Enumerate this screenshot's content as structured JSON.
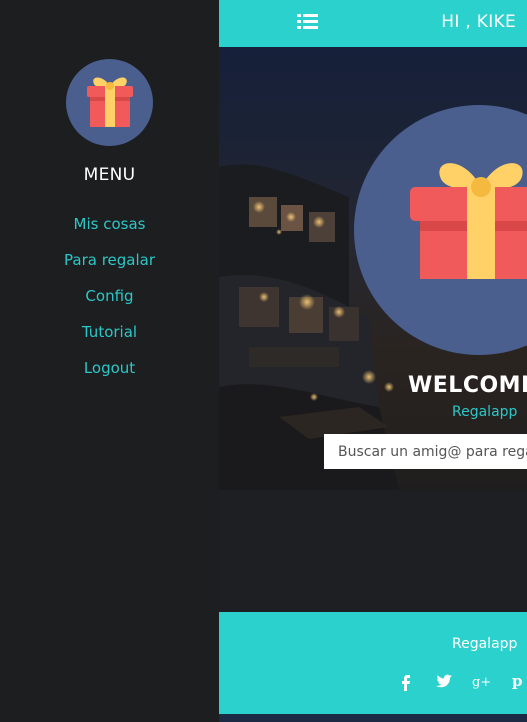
{
  "sidebar": {
    "logo": "gift-icon",
    "menu_title": "MENU",
    "items": [
      {
        "label": "Mis cosas"
      },
      {
        "label": "Para regalar"
      },
      {
        "label": "Config"
      },
      {
        "label": "Tutorial"
      },
      {
        "label": "Logout"
      }
    ]
  },
  "header": {
    "menu_icon": "list-icon",
    "greeting": "HI , KIKE"
  },
  "hero": {
    "logo": "gift-icon",
    "title": "WELCOME",
    "subtitle": "Regalapp",
    "search_placeholder": "Buscar un amig@ para regalar"
  },
  "footer": {
    "title": "Regalapp",
    "social": [
      {
        "icon": "facebook-icon",
        "glyph": "f"
      },
      {
        "icon": "twitter-icon",
        "glyph": "t"
      },
      {
        "icon": "google-plus-icon",
        "glyph": "g+"
      },
      {
        "icon": "pinterest-icon",
        "glyph": "p"
      }
    ]
  },
  "colors": {
    "accent": "#2bd1cc",
    "link": "#2dc7c7",
    "sidebar_bg": "#1c1e20",
    "circle": "#4a5f8e",
    "gift_red": "#f05a5a",
    "gift_yellow": "#ffd166"
  }
}
